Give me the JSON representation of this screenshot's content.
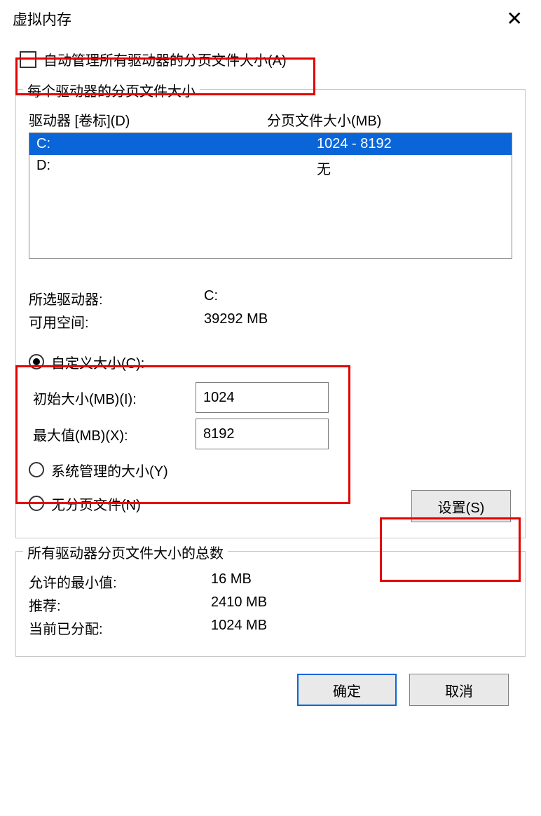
{
  "title": "虚拟内存",
  "auto_manage": {
    "label": "自动管理所有驱动器的分页文件大小(A)"
  },
  "group_per_drive": {
    "legend": "每个驱动器的分页文件大小",
    "col_drive": "驱动器 [卷标](D)",
    "col_size": "分页文件大小(MB)",
    "rows": [
      {
        "drive": "C:",
        "size": "1024 - 8192",
        "selected": true
      },
      {
        "drive": "D:",
        "size": "无",
        "selected": false
      }
    ],
    "selected_drive_label": "所选驱动器:",
    "selected_drive_value": "C:",
    "free_space_label": "可用空间:",
    "free_space_value": "39292 MB",
    "radio_custom": "自定义大小(C):",
    "initial_label": "初始大小(MB)(I):",
    "initial_value": "1024",
    "max_label": "最大值(MB)(X):",
    "max_value": "8192",
    "radio_system": "系统管理的大小(Y)",
    "radio_none": "无分页文件(N)",
    "set_button": "设置(S)"
  },
  "group_totals": {
    "legend": "所有驱动器分页文件大小的总数",
    "min_label": "允许的最小值:",
    "min_value": "16 MB",
    "rec_label": "推荐:",
    "rec_value": "2410 MB",
    "cur_label": "当前已分配:",
    "cur_value": "1024 MB"
  },
  "footer": {
    "ok": "确定",
    "cancel": "取消"
  }
}
